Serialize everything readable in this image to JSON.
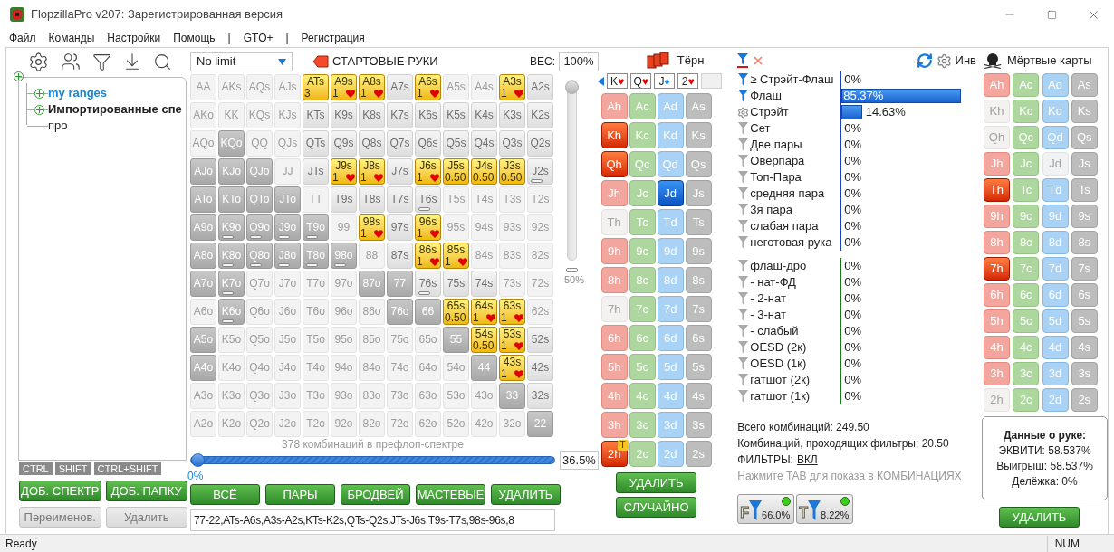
{
  "window": {
    "title": "FlopzillaPro v207: Зарегистрированная версия"
  },
  "menu": [
    "Файл",
    "Команды",
    "Настройки",
    "Помощь",
    "|",
    "GTO+",
    "|",
    "Регистрация"
  ],
  "tree": {
    "expandable": true,
    "children": [
      {
        "label": "my ranges",
        "kind": "link",
        "expandable": true
      },
      {
        "label": "Импортированные спе",
        "kind": "bold",
        "expandable": true
      },
      {
        "label": "про",
        "kind": "plain",
        "expandable": false
      }
    ]
  },
  "key_tabs": [
    "CTRL",
    "SHIFT",
    "CTRL+SHIFT"
  ],
  "left_buttons": [
    {
      "label": "ДОБ. СПЕКТР",
      "disabled": false
    },
    {
      "label": "ДОБ. ПАПКУ",
      "disabled": false
    },
    {
      "label": "Переименов.",
      "disabled": true
    },
    {
      "label": "Удалить",
      "disabled": true
    }
  ],
  "range": {
    "game": "No limit",
    "heading": "СТАРТОВЫЕ РУКИ",
    "weight_label": "ВЕС:",
    "weight_value": "100%",
    "weight_slider": {
      "level": 1,
      "reading": "50%"
    },
    "combos_caption": "378 комбинаций в префлоп-спектре",
    "range_slider": {
      "level": 0,
      "reading": "0%"
    },
    "percent_value": "36.5%",
    "rows": [
      [
        {
          "label": "AA",
          "kind": "faint",
          "bar": false
        },
        {
          "label": "AKs",
          "kind": "faint",
          "bar": false
        },
        {
          "label": "AQs",
          "kind": "faint",
          "bar": false
        },
        {
          "label": "AJs",
          "kind": "faint",
          "bar": false
        },
        {
          "label": "ATs",
          "kind": "picked",
          "bar": false,
          "weight": "3",
          "heart": false
        },
        {
          "label": "A9s",
          "kind": "picked",
          "bar": false,
          "weight": "1",
          "heart": true
        },
        {
          "label": "A8s",
          "kind": "picked",
          "bar": false,
          "weight": "1",
          "heart": true
        },
        {
          "label": "A7s",
          "kind": "normal",
          "bar": false
        },
        {
          "label": "A6s",
          "kind": "picked",
          "bar": false,
          "weight": "1",
          "heart": true
        },
        {
          "label": "A5s",
          "kind": "faint",
          "bar": false
        },
        {
          "label": "A4s",
          "kind": "faint",
          "bar": false
        },
        {
          "label": "A3s",
          "kind": "picked",
          "bar": false,
          "weight": "1",
          "heart": true
        },
        {
          "label": "A2s",
          "kind": "normal",
          "bar": false
        }
      ],
      [
        {
          "label": "AKo",
          "kind": "faint",
          "bar": false
        },
        {
          "label": "KK",
          "kind": "faint",
          "bar": false
        },
        {
          "label": "KQs",
          "kind": "faint",
          "bar": false
        },
        {
          "label": "KJs",
          "kind": "faint",
          "bar": false
        },
        {
          "label": "KTs",
          "kind": "normal",
          "bar": false
        },
        {
          "label": "K9s",
          "kind": "normal",
          "bar": false
        },
        {
          "label": "K8s",
          "kind": "normal",
          "bar": false
        },
        {
          "label": "K7s",
          "kind": "normal",
          "bar": false
        },
        {
          "label": "K6s",
          "kind": "normal",
          "bar": false
        },
        {
          "label": "K5s",
          "kind": "normal",
          "bar": false
        },
        {
          "label": "K4s",
          "kind": "normal",
          "bar": false
        },
        {
          "label": "K3s",
          "kind": "normal",
          "bar": false
        },
        {
          "label": "K2s",
          "kind": "normal",
          "bar": false
        }
      ],
      [
        {
          "label": "AQo",
          "kind": "faint",
          "bar": false
        },
        {
          "label": "KQo",
          "kind": "dark",
          "bar": false
        },
        {
          "label": "QQ",
          "kind": "faint",
          "bar": false
        },
        {
          "label": "QJs",
          "kind": "faint",
          "bar": false
        },
        {
          "label": "QTs",
          "kind": "normal",
          "bar": false
        },
        {
          "label": "Q9s",
          "kind": "normal",
          "bar": false
        },
        {
          "label": "Q8s",
          "kind": "normal",
          "bar": false
        },
        {
          "label": "Q7s",
          "kind": "normal",
          "bar": false
        },
        {
          "label": "Q6s",
          "kind": "normal",
          "bar": false
        },
        {
          "label": "Q5s",
          "kind": "normal",
          "bar": false
        },
        {
          "label": "Q4s",
          "kind": "normal",
          "bar": false
        },
        {
          "label": "Q3s",
          "kind": "normal",
          "bar": false
        },
        {
          "label": "Q2s",
          "kind": "normal",
          "bar": false
        }
      ],
      [
        {
          "label": "AJo",
          "kind": "dark",
          "bar": false
        },
        {
          "label": "KJo",
          "kind": "dark",
          "bar": false
        },
        {
          "label": "QJo",
          "kind": "dark",
          "bar": false
        },
        {
          "label": "JJ",
          "kind": "faint",
          "bar": false
        },
        {
          "label": "JTs",
          "kind": "normal",
          "bar": false
        },
        {
          "label": "J9s",
          "kind": "picked",
          "bar": false,
          "weight": "1",
          "heart": true
        },
        {
          "label": "J8s",
          "kind": "picked",
          "bar": false,
          "weight": "1",
          "heart": true
        },
        {
          "label": "J7s",
          "kind": "normal",
          "bar": false
        },
        {
          "label": "J6s",
          "kind": "picked",
          "bar": false,
          "weight": "1",
          "heart": true
        },
        {
          "label": "J5s",
          "kind": "picked",
          "bar": false,
          "weight": "0.50",
          "heart": false
        },
        {
          "label": "J4s",
          "kind": "picked",
          "bar": false,
          "weight": "0.50",
          "heart": false
        },
        {
          "label": "J3s",
          "kind": "picked",
          "bar": false,
          "weight": "0.50",
          "heart": false
        },
        {
          "label": "J2s",
          "kind": "normal",
          "bar": true
        }
      ],
      [
        {
          "label": "ATo",
          "kind": "dark",
          "bar": false
        },
        {
          "label": "KTo",
          "kind": "dark",
          "bar": false
        },
        {
          "label": "QTo",
          "kind": "dark",
          "bar": false
        },
        {
          "label": "JTo",
          "kind": "dark",
          "bar": false
        },
        {
          "label": "TT",
          "kind": "faint",
          "bar": false
        },
        {
          "label": "T9s",
          "kind": "normal",
          "bar": false
        },
        {
          "label": "T8s",
          "kind": "normal",
          "bar": false
        },
        {
          "label": "T7s",
          "kind": "normal",
          "bar": false
        },
        {
          "label": "T6s",
          "kind": "normal",
          "bar": true
        },
        {
          "label": "T5s",
          "kind": "faint",
          "bar": false
        },
        {
          "label": "T4s",
          "kind": "faint",
          "bar": false
        },
        {
          "label": "T3s",
          "kind": "faint",
          "bar": false
        },
        {
          "label": "T2s",
          "kind": "faint",
          "bar": false
        }
      ],
      [
        {
          "label": "A9o",
          "kind": "dark",
          "bar": false
        },
        {
          "label": "K9o",
          "kind": "dark",
          "bar": true
        },
        {
          "label": "Q9o",
          "kind": "dark",
          "bar": true
        },
        {
          "label": "J9o",
          "kind": "dark",
          "bar": true
        },
        {
          "label": "T9o",
          "kind": "dark",
          "bar": true
        },
        {
          "label": "99",
          "kind": "faint",
          "bar": false
        },
        {
          "label": "98s",
          "kind": "picked",
          "bar": false,
          "weight": "1",
          "heart": true
        },
        {
          "label": "97s",
          "kind": "normal",
          "bar": false
        },
        {
          "label": "96s",
          "kind": "picked",
          "bar": false,
          "weight": "1",
          "heart": true
        },
        {
          "label": "95s",
          "kind": "faint",
          "bar": false
        },
        {
          "label": "94s",
          "kind": "faint",
          "bar": false
        },
        {
          "label": "93s",
          "kind": "faint",
          "bar": false
        },
        {
          "label": "92s",
          "kind": "faint",
          "bar": false
        }
      ],
      [
        {
          "label": "A8o",
          "kind": "dark",
          "bar": false
        },
        {
          "label": "K8o",
          "kind": "dark",
          "bar": true
        },
        {
          "label": "Q8o",
          "kind": "dark",
          "bar": true
        },
        {
          "label": "J8o",
          "kind": "dark",
          "bar": true
        },
        {
          "label": "T8o",
          "kind": "dark",
          "bar": true
        },
        {
          "label": "98o",
          "kind": "dark",
          "bar": true
        },
        {
          "label": "88",
          "kind": "faint",
          "bar": false
        },
        {
          "label": "87s",
          "kind": "normal",
          "bar": false
        },
        {
          "label": "86s",
          "kind": "picked",
          "bar": false,
          "weight": "1",
          "heart": true
        },
        {
          "label": "85s",
          "kind": "picked",
          "bar": false,
          "weight": "1",
          "heart": true
        },
        {
          "label": "84s",
          "kind": "faint",
          "bar": false
        },
        {
          "label": "83s",
          "kind": "faint",
          "bar": false
        },
        {
          "label": "82s",
          "kind": "faint",
          "bar": false
        }
      ],
      [
        {
          "label": "A7o",
          "kind": "dark",
          "bar": false
        },
        {
          "label": "K7o",
          "kind": "dark",
          "bar": true
        },
        {
          "label": "Q7o",
          "kind": "faint",
          "bar": false
        },
        {
          "label": "J7o",
          "kind": "faint",
          "bar": false
        },
        {
          "label": "T7o",
          "kind": "faint",
          "bar": false
        },
        {
          "label": "97o",
          "kind": "faint",
          "bar": false
        },
        {
          "label": "87o",
          "kind": "dark",
          "bar": false
        },
        {
          "label": "77",
          "kind": "dark",
          "bar": false
        },
        {
          "label": "76s",
          "kind": "normal",
          "bar": true
        },
        {
          "label": "75s",
          "kind": "normal",
          "bar": false
        },
        {
          "label": "74s",
          "kind": "normal",
          "bar": false
        },
        {
          "label": "73s",
          "kind": "faint",
          "bar": false
        },
        {
          "label": "72s",
          "kind": "faint",
          "bar": false
        }
      ],
      [
        {
          "label": "A6o",
          "kind": "faint",
          "bar": false
        },
        {
          "label": "K6o",
          "kind": "dark",
          "bar": true
        },
        {
          "label": "Q6o",
          "kind": "faint",
          "bar": false
        },
        {
          "label": "J6o",
          "kind": "faint",
          "bar": false
        },
        {
          "label": "T6o",
          "kind": "faint",
          "bar": false
        },
        {
          "label": "96o",
          "kind": "faint",
          "bar": false
        },
        {
          "label": "86o",
          "kind": "faint",
          "bar": false
        },
        {
          "label": "76o",
          "kind": "dark",
          "bar": false
        },
        {
          "label": "66",
          "kind": "dark",
          "bar": false
        },
        {
          "label": "65s",
          "kind": "picked",
          "bar": false,
          "weight": "0.50",
          "heart": false
        },
        {
          "label": "64s",
          "kind": "picked",
          "bar": false,
          "weight": "1",
          "heart": true
        },
        {
          "label": "63s",
          "kind": "picked",
          "bar": false,
          "weight": "1",
          "heart": true
        },
        {
          "label": "62s",
          "kind": "faint",
          "bar": false
        }
      ],
      [
        {
          "label": "A5o",
          "kind": "dark",
          "bar": false
        },
        {
          "label": "K5o",
          "kind": "faint",
          "bar": false
        },
        {
          "label": "Q5o",
          "kind": "faint",
          "bar": false
        },
        {
          "label": "J5o",
          "kind": "faint",
          "bar": false
        },
        {
          "label": "T5o",
          "kind": "faint",
          "bar": false
        },
        {
          "label": "95o",
          "kind": "faint",
          "bar": false
        },
        {
          "label": "85o",
          "kind": "faint",
          "bar": false
        },
        {
          "label": "75o",
          "kind": "faint",
          "bar": false
        },
        {
          "label": "65o",
          "kind": "faint",
          "bar": false
        },
        {
          "label": "55",
          "kind": "dark",
          "bar": false
        },
        {
          "label": "54s",
          "kind": "picked",
          "bar": false,
          "weight": "0.50",
          "heart": false
        },
        {
          "label": "53s",
          "kind": "picked",
          "bar": false,
          "weight": "1",
          "heart": true
        },
        {
          "label": "52s",
          "kind": "normal",
          "bar": false
        }
      ],
      [
        {
          "label": "A4o",
          "kind": "dark",
          "bar": false
        },
        {
          "label": "K4o",
          "kind": "faint",
          "bar": false
        },
        {
          "label": "Q4o",
          "kind": "faint",
          "bar": false
        },
        {
          "label": "J4o",
          "kind": "faint",
          "bar": false
        },
        {
          "label": "T4o",
          "kind": "faint",
          "bar": false
        },
        {
          "label": "94o",
          "kind": "faint",
          "bar": false
        },
        {
          "label": "84o",
          "kind": "faint",
          "bar": false
        },
        {
          "label": "74o",
          "kind": "faint",
          "bar": false
        },
        {
          "label": "64o",
          "kind": "faint",
          "bar": false
        },
        {
          "label": "54o",
          "kind": "faint",
          "bar": false
        },
        {
          "label": "44",
          "kind": "dark",
          "bar": false
        },
        {
          "label": "43s",
          "kind": "picked",
          "bar": false,
          "weight": "1",
          "heart": true
        },
        {
          "label": "42s",
          "kind": "normal",
          "bar": false
        }
      ],
      [
        {
          "label": "A3o",
          "kind": "faint",
          "bar": false
        },
        {
          "label": "K3o",
          "kind": "faint",
          "bar": false
        },
        {
          "label": "Q3o",
          "kind": "faint",
          "bar": false
        },
        {
          "label": "J3o",
          "kind": "faint",
          "bar": false
        },
        {
          "label": "T3o",
          "kind": "faint",
          "bar": false
        },
        {
          "label": "93o",
          "kind": "faint",
          "bar": false
        },
        {
          "label": "83o",
          "kind": "faint",
          "bar": false
        },
        {
          "label": "73o",
          "kind": "faint",
          "bar": false
        },
        {
          "label": "63o",
          "kind": "faint",
          "bar": false
        },
        {
          "label": "53o",
          "kind": "faint",
          "bar": false
        },
        {
          "label": "43o",
          "kind": "faint",
          "bar": false
        },
        {
          "label": "33",
          "kind": "dark",
          "bar": false
        },
        {
          "label": "32s",
          "kind": "normal",
          "bar": false
        }
      ],
      [
        {
          "label": "A2o",
          "kind": "faint",
          "bar": false
        },
        {
          "label": "K2o",
          "kind": "faint",
          "bar": false
        },
        {
          "label": "Q2o",
          "kind": "faint",
          "bar": false
        },
        {
          "label": "J2o",
          "kind": "faint",
          "bar": false
        },
        {
          "label": "T2o",
          "kind": "faint",
          "bar": false
        },
        {
          "label": "92o",
          "kind": "faint",
          "bar": false
        },
        {
          "label": "82o",
          "kind": "faint",
          "bar": false
        },
        {
          "label": "72o",
          "kind": "faint",
          "bar": false
        },
        {
          "label": "62o",
          "kind": "faint",
          "bar": false
        },
        {
          "label": "52o",
          "kind": "faint",
          "bar": false
        },
        {
          "label": "42o",
          "kind": "faint",
          "bar": false
        },
        {
          "label": "32o",
          "kind": "faint",
          "bar": false
        },
        {
          "label": "22",
          "kind": "dark",
          "bar": false
        }
      ]
    ],
    "buttons": [
      "ВСЁ",
      "ПАРЫ",
      "БРОДВЕЙ",
      "МАСТЕВЫЕ",
      "УДАЛИТЬ"
    ],
    "range_text": "77-22,ATs-A6s,A3s-A2s,KTs-K2s,QTs-Q2s,JTs-J6s,T9s-T7s,98s-96s,8"
  },
  "turn": {
    "title": "Тёрн",
    "board": [
      {
        "rank": "K",
        "symbol": "♥",
        "kind": "hearts"
      },
      {
        "rank": "Q",
        "symbol": "♥",
        "kind": "hearts"
      },
      {
        "rank": "J",
        "symbol": "♦",
        "kind": "diamonds"
      },
      {
        "rank": "2",
        "symbol": "♥",
        "kind": "hearts"
      }
    ],
    "cards": [
      {
        "label": "Ah",
        "kind": "hearts",
        "selected": false,
        "disabled": false
      },
      {
        "label": "Ac",
        "kind": "clubs",
        "selected": false,
        "disabled": false
      },
      {
        "label": "Ad",
        "kind": "diamonds",
        "selected": false,
        "disabled": false
      },
      {
        "label": "As",
        "kind": "spades",
        "selected": false,
        "disabled": false
      },
      {
        "label": "Kh",
        "kind": "hearts",
        "selected": true,
        "disabled": false
      },
      {
        "label": "Kc",
        "kind": "clubs",
        "selected": false,
        "disabled": false
      },
      {
        "label": "Kd",
        "kind": "diamonds",
        "selected": false,
        "disabled": false
      },
      {
        "label": "Ks",
        "kind": "spades",
        "selected": false,
        "disabled": false
      },
      {
        "label": "Qh",
        "kind": "hearts",
        "selected": true,
        "disabled": false
      },
      {
        "label": "Qc",
        "kind": "clubs",
        "selected": false,
        "disabled": false
      },
      {
        "label": "Qd",
        "kind": "diamonds",
        "selected": false,
        "disabled": false
      },
      {
        "label": "Qs",
        "kind": "spades",
        "selected": false,
        "disabled": false
      },
      {
        "label": "Jh",
        "kind": "hearts",
        "selected": false,
        "disabled": false
      },
      {
        "label": "Jc",
        "kind": "clubs",
        "selected": false,
        "disabled": false
      },
      {
        "label": "Jd",
        "kind": "diamonds",
        "selected": true,
        "disabled": false
      },
      {
        "label": "Js",
        "kind": "spades",
        "selected": false,
        "disabled": false
      },
      {
        "label": "Th",
        "kind": "hearts",
        "selected": false,
        "disabled": true
      },
      {
        "label": "Tc",
        "kind": "clubs",
        "selected": false,
        "disabled": false
      },
      {
        "label": "Td",
        "kind": "diamonds",
        "selected": false,
        "disabled": false
      },
      {
        "label": "Ts",
        "kind": "spades",
        "selected": false,
        "disabled": false
      },
      {
        "label": "9h",
        "kind": "hearts",
        "selected": false,
        "disabled": false
      },
      {
        "label": "9c",
        "kind": "clubs",
        "selected": false,
        "disabled": false
      },
      {
        "label": "9d",
        "kind": "diamonds",
        "selected": false,
        "disabled": false
      },
      {
        "label": "9s",
        "kind": "spades",
        "selected": false,
        "disabled": false
      },
      {
        "label": "8h",
        "kind": "hearts",
        "selected": false,
        "disabled": false
      },
      {
        "label": "8c",
        "kind": "clubs",
        "selected": false,
        "disabled": false
      },
      {
        "label": "8d",
        "kind": "diamonds",
        "selected": false,
        "disabled": false
      },
      {
        "label": "8s",
        "kind": "spades",
        "selected": false,
        "disabled": false
      },
      {
        "label": "7h",
        "kind": "hearts",
        "selected": false,
        "disabled": true
      },
      {
        "label": "7c",
        "kind": "clubs",
        "selected": false,
        "disabled": false
      },
      {
        "label": "7d",
        "kind": "diamonds",
        "selected": false,
        "disabled": false
      },
      {
        "label": "7s",
        "kind": "spades",
        "selected": false,
        "disabled": false
      },
      {
        "label": "6h",
        "kind": "hearts",
        "selected": false,
        "disabled": false
      },
      {
        "label": "6c",
        "kind": "clubs",
        "selected": false,
        "disabled": false
      },
      {
        "label": "6d",
        "kind": "diamonds",
        "selected": false,
        "disabled": false
      },
      {
        "label": "6s",
        "kind": "spades",
        "selected": false,
        "disabled": false
      },
      {
        "label": "5h",
        "kind": "hearts",
        "selected": false,
        "disabled": false
      },
      {
        "label": "5c",
        "kind": "clubs",
        "selected": false,
        "disabled": false
      },
      {
        "label": "5d",
        "kind": "diamonds",
        "selected": false,
        "disabled": false
      },
      {
        "label": "5s",
        "kind": "spades",
        "selected": false,
        "disabled": false
      },
      {
        "label": "4h",
        "kind": "hearts",
        "selected": false,
        "disabled": false
      },
      {
        "label": "4c",
        "kind": "clubs",
        "selected": false,
        "disabled": false
      },
      {
        "label": "4d",
        "kind": "diamonds",
        "selected": false,
        "disabled": false
      },
      {
        "label": "4s",
        "kind": "spades",
        "selected": false,
        "disabled": false
      },
      {
        "label": "3h",
        "kind": "hearts",
        "selected": false,
        "disabled": false
      },
      {
        "label": "3c",
        "kind": "clubs",
        "selected": false,
        "disabled": false
      },
      {
        "label": "3d",
        "kind": "diamonds",
        "selected": false,
        "disabled": false
      },
      {
        "label": "3s",
        "kind": "spades",
        "selected": false,
        "disabled": false
      },
      {
        "label": "2h",
        "kind": "hearts",
        "selected": true,
        "disabled": false,
        "badge": "T"
      },
      {
        "label": "2c",
        "kind": "clubs",
        "selected": false,
        "disabled": false
      },
      {
        "label": "2d",
        "kind": "diamonds",
        "selected": false,
        "disabled": false
      },
      {
        "label": "2s",
        "kind": "spades",
        "selected": false,
        "disabled": false
      }
    ],
    "buttons": [
      "УДАЛИТЬ",
      "СЛУЧАЙНО"
    ]
  },
  "stats": {
    "invert_label": "Инв",
    "groups": [
      {
        "kind": "made",
        "rows": [
          {
            "label": "≥ Стрэйт-Флаш",
            "value": "0%",
            "kind": "active"
          },
          {
            "label": "Флаш",
            "value": "85.37%",
            "kind": "active",
            "level": 0.8537
          },
          {
            "label": "Стрэйт",
            "value": "14.63%",
            "kind": "gear",
            "level": 0.1463
          },
          {
            "label": "Сет",
            "value": "0%",
            "kind": "off"
          },
          {
            "label": "Две пары",
            "value": "0%",
            "kind": "off"
          },
          {
            "label": "Оверпара",
            "value": "0%",
            "kind": "off"
          },
          {
            "label": "Топ-Пара",
            "value": "0%",
            "kind": "off"
          },
          {
            "label": "средняя пара",
            "value": "0%",
            "kind": "off"
          },
          {
            "label": "3я пара",
            "value": "0%",
            "kind": "off"
          },
          {
            "label": "слабая пара",
            "value": "0%",
            "kind": "off"
          },
          {
            "label": "неготовая рука",
            "value": "0%",
            "kind": "off"
          }
        ]
      },
      {
        "kind": "draws",
        "rows": [
          {
            "label": "флаш-дро",
            "value": "0%",
            "kind": "off"
          },
          {
            "label": "- нат-ФД",
            "value": "0%",
            "kind": "off"
          },
          {
            "label": "- 2-нат",
            "value": "0%",
            "kind": "off"
          },
          {
            "label": "- 3-нат",
            "value": "0%",
            "kind": "off"
          },
          {
            "label": "- слабый",
            "value": "0%",
            "kind": "off"
          },
          {
            "label": "OESD (2к)",
            "value": "0%",
            "kind": "off"
          },
          {
            "label": "OESD (1к)",
            "value": "0%",
            "kind": "off"
          },
          {
            "label": "гатшот (2к)",
            "value": "0%",
            "kind": "off"
          },
          {
            "label": "гатшот (1к)",
            "value": "0%",
            "kind": "off"
          }
        ]
      }
    ],
    "total": "Всего комбинаций: 249.50",
    "passing": "Комбинаций, проходящих фильтры: 20.50",
    "filters_label": "ФИЛЬТРЫ:",
    "filters_link": "ВКЛ",
    "hint": "Нажмите TAB для показа в КОМБИНАЦИЯХ",
    "filter_buttons": [
      {
        "letter": "F",
        "value": "66.0%",
        "on": true
      },
      {
        "letter": "T",
        "value": "8.22%",
        "on": true
      }
    ]
  },
  "dead": {
    "title": "Мёртвые карты",
    "cards": [
      {
        "label": "Ah",
        "kind": "hearts",
        "selected": false,
        "disabled": false
      },
      {
        "label": "Ac",
        "kind": "clubs",
        "selected": false,
        "disabled": false
      },
      {
        "label": "Ad",
        "kind": "diamonds",
        "selected": false,
        "disabled": false
      },
      {
        "label": "As",
        "kind": "spades",
        "selected": false,
        "disabled": false
      },
      {
        "label": "Kh",
        "kind": "hearts",
        "selected": false,
        "disabled": true
      },
      {
        "label": "Kc",
        "kind": "clubs",
        "selected": false,
        "disabled": false
      },
      {
        "label": "Kd",
        "kind": "diamonds",
        "selected": false,
        "disabled": false
      },
      {
        "label": "Ks",
        "kind": "spades",
        "selected": false,
        "disabled": false
      },
      {
        "label": "Qh",
        "kind": "hearts",
        "selected": false,
        "disabled": true
      },
      {
        "label": "Qc",
        "kind": "clubs",
        "selected": false,
        "disabled": false
      },
      {
        "label": "Qd",
        "kind": "diamonds",
        "selected": false,
        "disabled": false
      },
      {
        "label": "Qs",
        "kind": "spades",
        "selected": false,
        "disabled": false
      },
      {
        "label": "Jh",
        "kind": "hearts",
        "selected": false,
        "disabled": false
      },
      {
        "label": "Jc",
        "kind": "clubs",
        "selected": false,
        "disabled": false
      },
      {
        "label": "Jd",
        "kind": "diamonds",
        "selected": false,
        "disabled": true
      },
      {
        "label": "Js",
        "kind": "spades",
        "selected": false,
        "disabled": false
      },
      {
        "label": "Th",
        "kind": "hearts",
        "selected": true,
        "disabled": false
      },
      {
        "label": "Tc",
        "kind": "clubs",
        "selected": false,
        "disabled": false
      },
      {
        "label": "Td",
        "kind": "diamonds",
        "selected": false,
        "disabled": false
      },
      {
        "label": "Ts",
        "kind": "spades",
        "selected": false,
        "disabled": false
      },
      {
        "label": "9h",
        "kind": "hearts",
        "selected": false,
        "disabled": false
      },
      {
        "label": "9c",
        "kind": "clubs",
        "selected": false,
        "disabled": false
      },
      {
        "label": "9d",
        "kind": "diamonds",
        "selected": false,
        "disabled": false
      },
      {
        "label": "9s",
        "kind": "spades",
        "selected": false,
        "disabled": false
      },
      {
        "label": "8h",
        "kind": "hearts",
        "selected": false,
        "disabled": false
      },
      {
        "label": "8c",
        "kind": "clubs",
        "selected": false,
        "disabled": false
      },
      {
        "label": "8d",
        "kind": "diamonds",
        "selected": false,
        "disabled": false
      },
      {
        "label": "8s",
        "kind": "spades",
        "selected": false,
        "disabled": false
      },
      {
        "label": "7h",
        "kind": "hearts",
        "selected": true,
        "disabled": false
      },
      {
        "label": "7c",
        "kind": "clubs",
        "selected": false,
        "disabled": false
      },
      {
        "label": "7d",
        "kind": "diamonds",
        "selected": false,
        "disabled": false
      },
      {
        "label": "7s",
        "kind": "spades",
        "selected": false,
        "disabled": false
      },
      {
        "label": "6h",
        "kind": "hearts",
        "selected": false,
        "disabled": false
      },
      {
        "label": "6c",
        "kind": "clubs",
        "selected": false,
        "disabled": false
      },
      {
        "label": "6d",
        "kind": "diamonds",
        "selected": false,
        "disabled": false
      },
      {
        "label": "6s",
        "kind": "spades",
        "selected": false,
        "disabled": false
      },
      {
        "label": "5h",
        "kind": "hearts",
        "selected": false,
        "disabled": false
      },
      {
        "label": "5c",
        "kind": "clubs",
        "selected": false,
        "disabled": false
      },
      {
        "label": "5d",
        "kind": "diamonds",
        "selected": false,
        "disabled": false
      },
      {
        "label": "5s",
        "kind": "spades",
        "selected": false,
        "disabled": false
      },
      {
        "label": "4h",
        "kind": "hearts",
        "selected": false,
        "disabled": false
      },
      {
        "label": "4c",
        "kind": "clubs",
        "selected": false,
        "disabled": false
      },
      {
        "label": "4d",
        "kind": "diamonds",
        "selected": false,
        "disabled": false
      },
      {
        "label": "4s",
        "kind": "spades",
        "selected": false,
        "disabled": false
      },
      {
        "label": "3h",
        "kind": "hearts",
        "selected": false,
        "disabled": false
      },
      {
        "label": "3c",
        "kind": "clubs",
        "selected": false,
        "disabled": false
      },
      {
        "label": "3d",
        "kind": "diamonds",
        "selected": false,
        "disabled": false
      },
      {
        "label": "3s",
        "kind": "spades",
        "selected": false,
        "disabled": false
      },
      {
        "label": "2h",
        "kind": "hearts",
        "selected": false,
        "disabled": true
      },
      {
        "label": "2c",
        "kind": "clubs",
        "selected": false,
        "disabled": false
      },
      {
        "label": "2d",
        "kind": "diamonds",
        "selected": false,
        "disabled": false
      },
      {
        "label": "2s",
        "kind": "spades",
        "selected": false,
        "disabled": false
      }
    ],
    "info_title": "Данные о руке:",
    "info_lines": [
      "ЭКВИТИ: 58.537%",
      "Выигрыш: 58.537%",
      "Делёжка: 0%"
    ],
    "button": "УДАЛИТЬ"
  },
  "status_bar": {
    "text": "Ready",
    "indicator": "NUM"
  }
}
